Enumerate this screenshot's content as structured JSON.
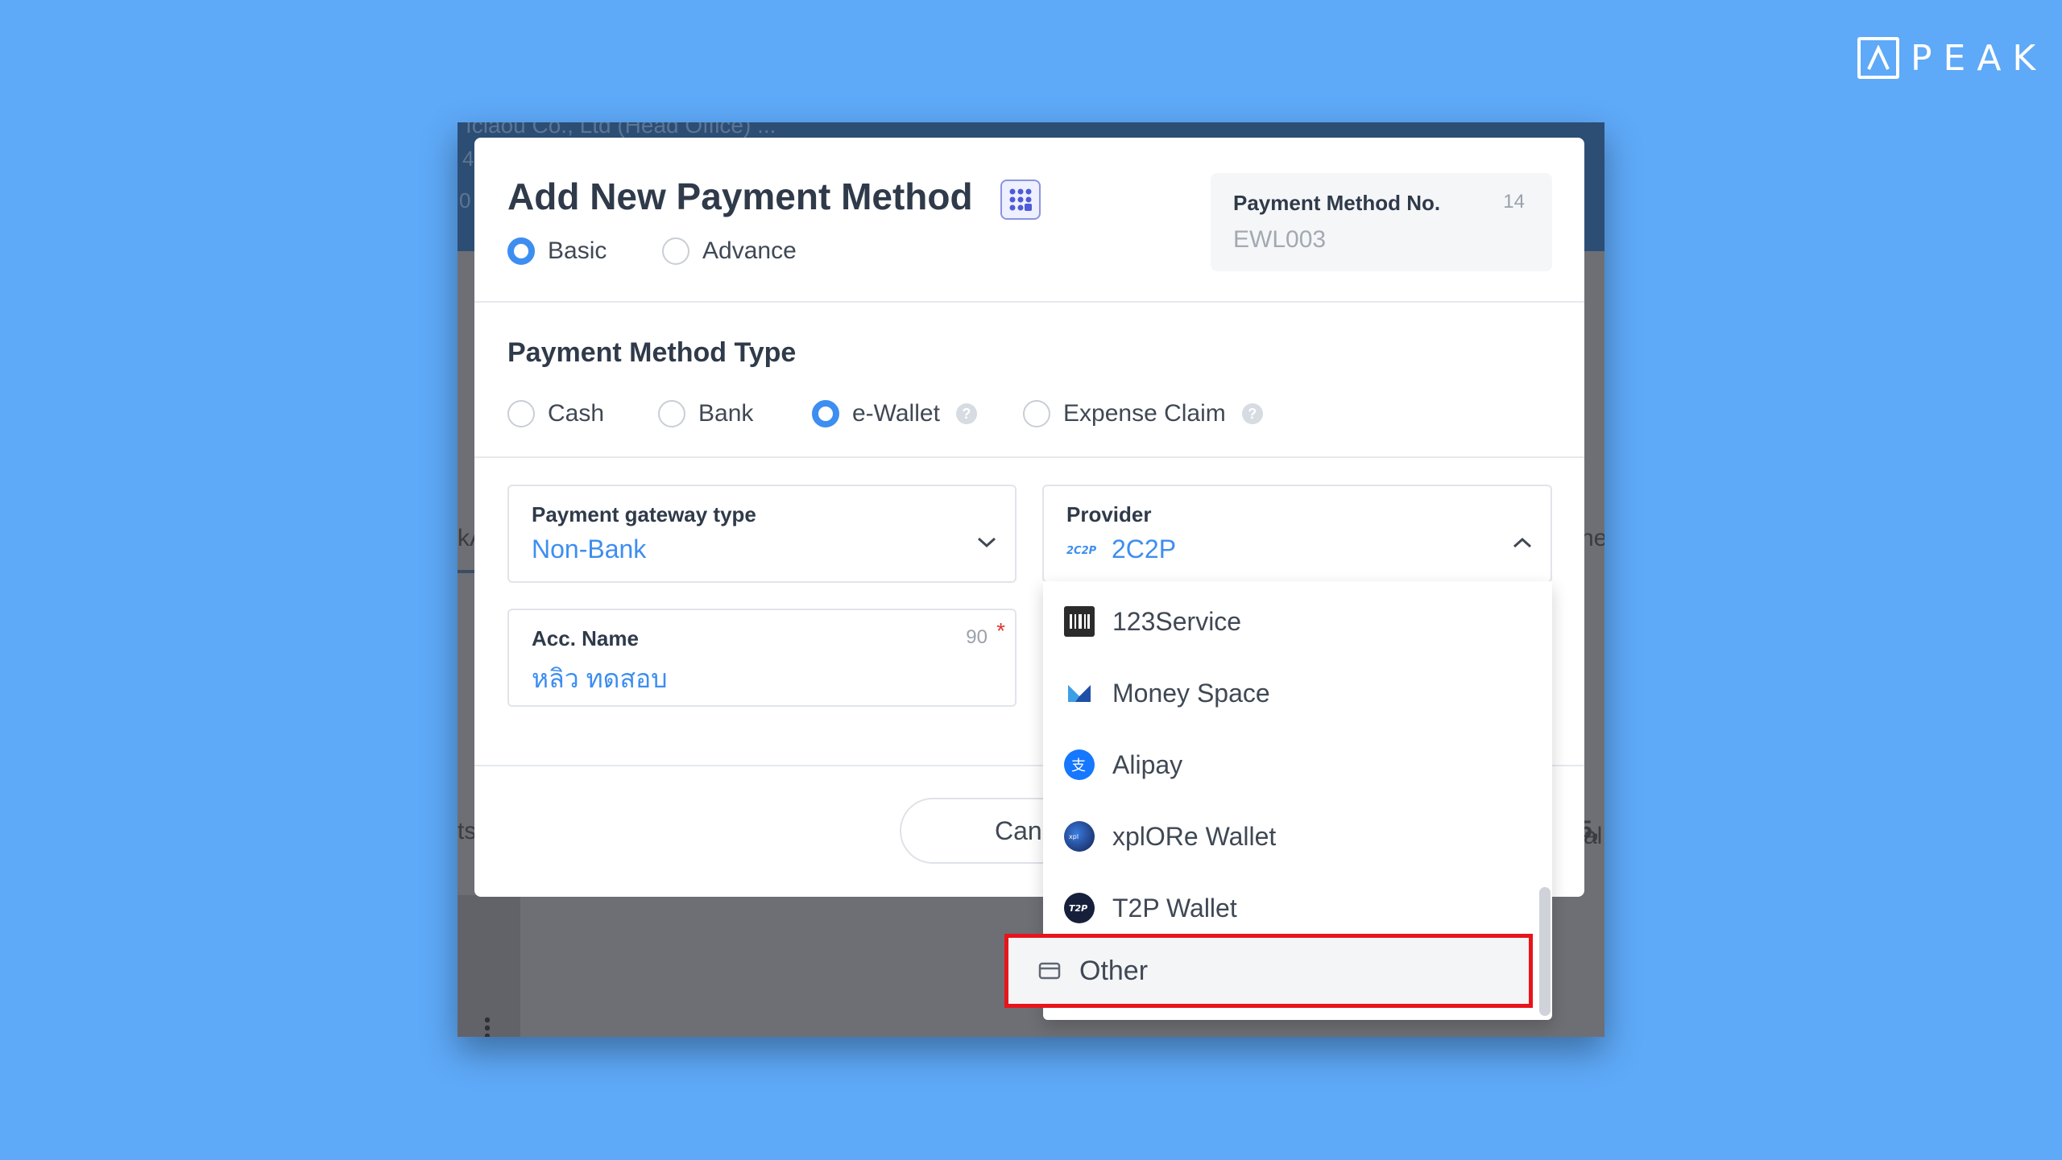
{
  "logo": {
    "text": "PEAK"
  },
  "background": {
    "header_text": "ıclaou Co., Ltd (Head Office) ...",
    "frag_1": "4",
    "frag_2": "0",
    "frag_3": "kA",
    "frag_4": "ts",
    "frag_5": "ne",
    "frag_6": "5,",
    "frag_7": "al"
  },
  "modal": {
    "title": "Add New Payment Method",
    "mode_options": [
      {
        "label": "Basic",
        "selected": true
      },
      {
        "label": "Advance",
        "selected": false
      }
    ],
    "payment_method_no": {
      "label": "Payment Method No.",
      "count": "14",
      "value": "EWL003"
    },
    "type_section_title": "Payment Method Type",
    "type_options": [
      {
        "label": "Cash",
        "selected": false
      },
      {
        "label": "Bank",
        "selected": false
      },
      {
        "label": "e-Wallet",
        "selected": true,
        "help": "?"
      },
      {
        "label": "Expense Claim",
        "selected": false,
        "help": "?"
      }
    ],
    "gateway_type": {
      "label": "Payment gateway type",
      "value": "Non-Bank"
    },
    "provider": {
      "label": "Provider",
      "value": "2C2P"
    },
    "acc_name": {
      "label": "Acc. Name",
      "count": "90",
      "required": "*",
      "value": "หลิว ทดสอบ"
    },
    "cancel_label": "Cancel"
  },
  "provider_dropdown": {
    "items": [
      {
        "label": "123Service",
        "icon": "123service-icon"
      },
      {
        "label": "Money Space",
        "icon": "money-space-icon"
      },
      {
        "label": "Alipay",
        "icon": "alipay-icon"
      },
      {
        "label": "xplORe Wallet",
        "icon": "xplore-wallet-icon"
      },
      {
        "label": "T2P Wallet",
        "icon": "t2p-wallet-icon"
      },
      {
        "label": "Other",
        "icon": "other-icon",
        "highlighted": true
      }
    ]
  },
  "colors": {
    "background": "#5ea9f8",
    "accent": "#3d8ef0",
    "highlight_border": "#e8141c"
  }
}
